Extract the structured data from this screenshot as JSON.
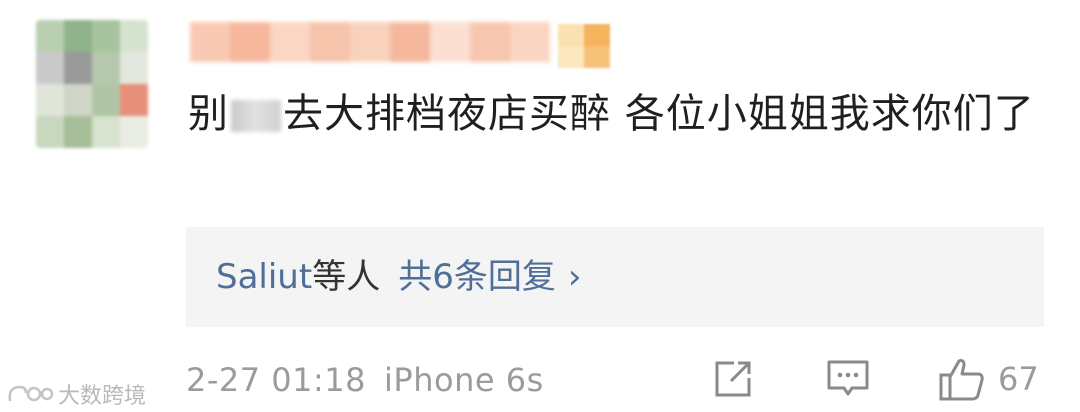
{
  "comment": {
    "text_before_mask": "别",
    "text_after_mask": "去大排档夜店买醉 各位小姐姐我求你们了"
  },
  "replies": {
    "name": "Saliut",
    "suffix": "等人",
    "count_text": "共6条回复",
    "chevron": "›"
  },
  "meta": {
    "datetime": "2-27 01:18",
    "source": "iPhone 6s"
  },
  "actions": {
    "share_icon": "share-icon",
    "comment_icon": "comment-icon",
    "like_icon": "thumbs-up-icon",
    "like_count": "67"
  },
  "watermark": {
    "text": "大数跨境"
  },
  "colors": {
    "link": "#4e6f97",
    "meta_gray": "#9b9b9b",
    "reply_bg": "#f4f4f4"
  }
}
